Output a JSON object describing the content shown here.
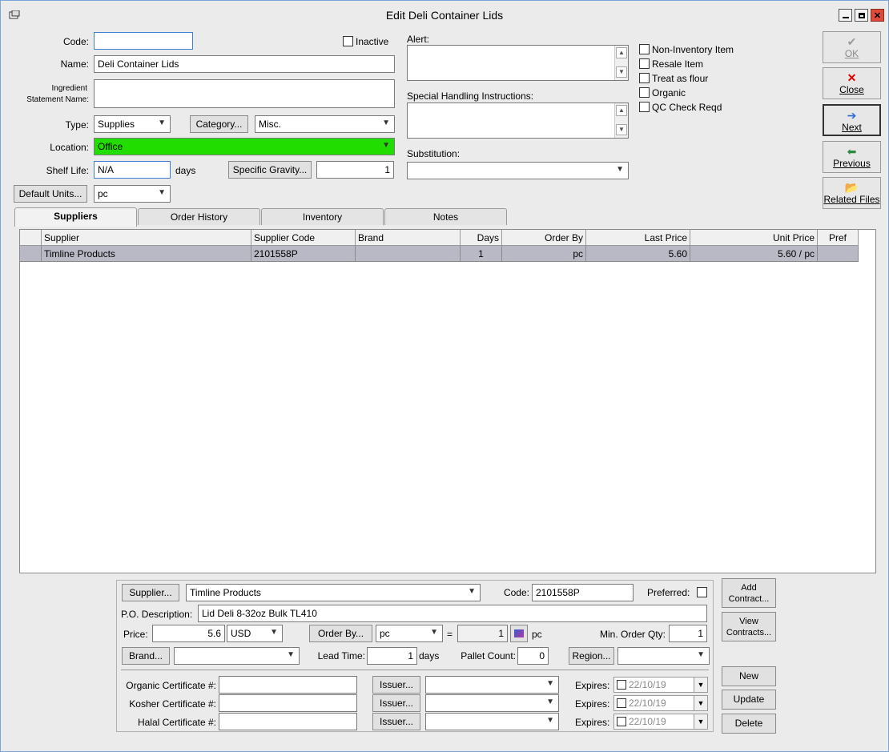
{
  "window": {
    "title": "Edit Deli Container Lids"
  },
  "form": {
    "code_label": "Code:",
    "code_value": "",
    "inactive_label": "Inactive",
    "name_label": "Name:",
    "name_value": "Deli Container Lids",
    "ingredient_label_1": "Ingredient",
    "ingredient_label_2": "Statement Name:",
    "ingredient_value": "",
    "type_label": "Type:",
    "type_value": "Supplies",
    "category_button": "Category...",
    "category_value": "Misc.",
    "location_label": "Location:",
    "location_value": "Office",
    "location_color": "#22dd00",
    "shelf_life_label": "Shelf Life:",
    "shelf_life_value": "N/A",
    "days_label": "days",
    "specific_gravity_button": "Specific Gravity...",
    "specific_gravity_value": "1",
    "default_units_button": "Default Units...",
    "default_units_value": "pc",
    "alert_label": "Alert:",
    "special_handling_label": "Special Handling Instructions:",
    "substitution_label": "Substitution:",
    "substitution_value": ""
  },
  "options": [
    {
      "label": "Non-Inventory Item",
      "checked": false
    },
    {
      "label": "Resale Item",
      "checked": false
    },
    {
      "label": "Treat as flour",
      "checked": false
    },
    {
      "label": "Organic",
      "checked": false
    },
    {
      "label": "QC Check Reqd",
      "checked": false
    }
  ],
  "side_buttons": {
    "ok": "OK",
    "close": "Close",
    "next": "Next",
    "previous": "Previous",
    "related_files": "Related Files"
  },
  "tabs": [
    "Suppliers",
    "Order History",
    "Inventory",
    "Notes"
  ],
  "grid": {
    "columns": [
      "Supplier",
      "Supplier Code",
      "Brand",
      "Days",
      "Order By",
      "Last Price",
      "Unit Price",
      "Pref"
    ],
    "rows": [
      [
        "Timline Products",
        "2101558P",
        "",
        "1",
        "pc",
        "5.60",
        "5.60 / pc",
        ""
      ]
    ]
  },
  "supplier_panel": {
    "supplier_button": "Supplier...",
    "supplier_value": "Timline Products",
    "code_label": "Code:",
    "code_value": "2101558P",
    "preferred_label": "Preferred:",
    "po_description_label": "P.O. Description:",
    "po_description_value": "Lid Deli 8-32oz Bulk TL410",
    "price_label": "Price:",
    "price_value": "5.6",
    "currency_value": "USD",
    "order_by_button": "Order By...",
    "order_by_value": "pc",
    "equals": "=",
    "conversion_value": "1",
    "conversion_unit": "pc",
    "min_order_label": "Min. Order Qty:",
    "min_order_value": "1",
    "brand_button": "Brand...",
    "brand_value": "",
    "lead_time_label": "Lead Time:",
    "lead_time_value": "1",
    "lead_time_unit": "days",
    "pallet_count_label": "Pallet Count:",
    "pallet_count_value": "0",
    "region_button": "Region...",
    "region_value": "",
    "certificates": [
      {
        "label": "Organic Certificate #:",
        "value": "",
        "issuer_button": "Issuer...",
        "issuer_value": "",
        "expires_label": "Expires:",
        "expires_value": "22/10/19"
      },
      {
        "label": "Kosher Certificate #:",
        "value": "",
        "issuer_button": "Issuer...",
        "issuer_value": "",
        "expires_label": "Expires:",
        "expires_value": "22/10/19"
      },
      {
        "label": "Halal Certificate #:",
        "value": "",
        "issuer_button": "Issuer...",
        "issuer_value": "",
        "expires_label": "Expires:",
        "expires_value": "22/10/19"
      }
    ],
    "add_contract_1": "Add",
    "add_contract_2": "Contract...",
    "view_contracts_1": "View",
    "view_contracts_2": "Contracts...",
    "new_button": "New",
    "update_button": "Update",
    "delete_button": "Delete"
  }
}
